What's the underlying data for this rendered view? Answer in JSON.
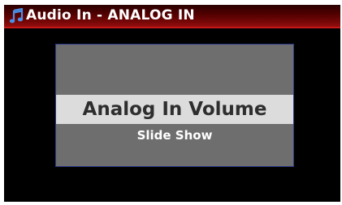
{
  "header": {
    "title": "Audio In - ANALOG IN",
    "icon": "music-note-icon"
  },
  "menu": {
    "items": [
      {
        "label": "Analog In Volume",
        "selected": true
      },
      {
        "label": "Slide Show",
        "selected": false
      }
    ]
  },
  "colors": {
    "title_bar": "#7a0808",
    "title_text": "#ffffff",
    "icon": "#4a90e8",
    "panel": "#6e6e6e",
    "panel_border": "#2a3a8a",
    "selected_item": "#dcdcdc",
    "selected_text": "#2e2e2e",
    "item_text": "#ffffff",
    "screen_background": "#000000"
  }
}
